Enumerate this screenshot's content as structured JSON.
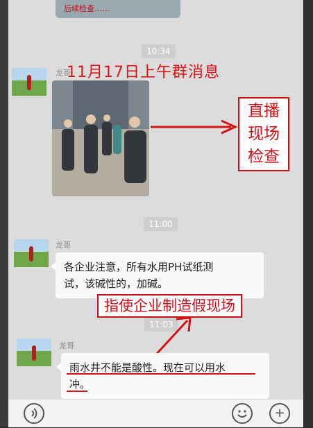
{
  "top_banner": {
    "text": "后续检查……"
  },
  "timestamps": [
    "10:34",
    "11:00",
    "11:03"
  ],
  "headline": "11月17日上午群消息",
  "messages": [
    {
      "sender": "龙哥",
      "type": "image"
    },
    {
      "sender": "龙哥",
      "line1": "各企业注意，所有水用PH试纸测",
      "line2": "试，该碱性的，加碱。"
    },
    {
      "sender": "龙哥",
      "line1": "雨水井不能是酸性。现在可以用水",
      "line2": "冲。"
    }
  ],
  "annotations": {
    "live_check": [
      "直播",
      "现场",
      "检查"
    ],
    "fake_scene": "指使企业制造假现场"
  },
  "bottom_bar": {
    "voice_icon": "voice-icon",
    "emoji_icon": "emoji-icon",
    "plus_icon": "plus-icon",
    "plus_glyph": "+"
  },
  "colors": {
    "annotation_red": "#d0121a",
    "bubble": "#fafafa",
    "chat_bg": "#dcdcdc"
  }
}
